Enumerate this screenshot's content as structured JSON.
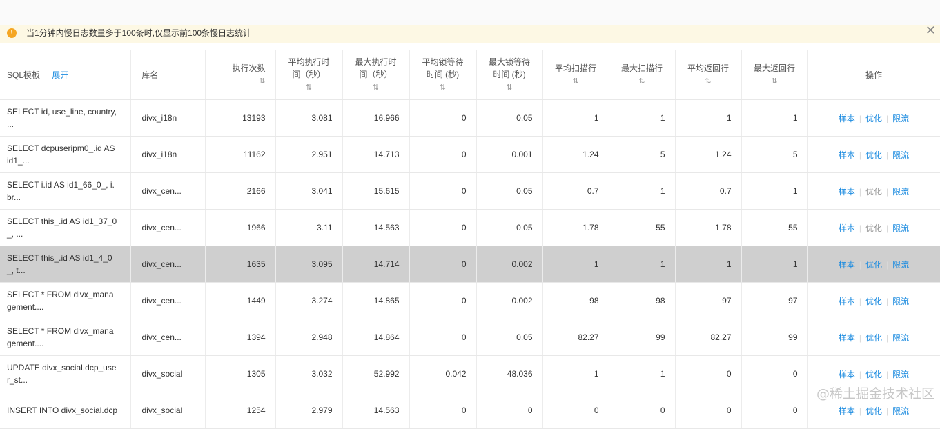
{
  "notice": {
    "message": "当1分钟内慢日志数量多于100条时,仅显示前100条慢日志统计",
    "close_symbol": "✕",
    "warn_icon": "exclamation"
  },
  "table": {
    "headers": {
      "sql": "SQL模板",
      "expand": "展开",
      "db": "库名",
      "exec_count": "执行次数",
      "avg_exec_1": "平均执行时",
      "avg_exec_2": "间（秒）",
      "max_exec_1": "最大执行时",
      "max_exec_2": "间（秒）",
      "avg_lock_1": "平均锁等待",
      "avg_lock_2": "时间 (秒)",
      "max_lock_1": "最大锁等待",
      "max_lock_2": "时间 (秒)",
      "avg_scan": "平均扫描行",
      "max_scan": "最大扫描行",
      "avg_return": "平均返回行",
      "max_return": "最大返回行",
      "ops": "操作",
      "sort_symbol": "⇅"
    },
    "rows": [
      {
        "sql1": "SELECT id, use_line, country,",
        "sql2": "...",
        "db": "divx_i18n",
        "count": "13193",
        "avg_exec": "3.081",
        "max_exec": "16.966",
        "avg_lock": "0",
        "max_lock": "0.05",
        "avg_scan": "1",
        "max_scan": "1",
        "avg_ret": "1",
        "max_ret": "1"
      },
      {
        "sql1": "SELECT dcpuseripm0_.id AS",
        "sql2": "id1_...",
        "db": "divx_i18n",
        "count": "11162",
        "avg_exec": "2.951",
        "max_exec": "14.713",
        "avg_lock": "0",
        "max_lock": "0.001",
        "avg_scan": "1.24",
        "max_scan": "5",
        "avg_ret": "1.24",
        "max_ret": "5"
      },
      {
        "sql1": "SELECT i.id AS id1_66_0_, i.",
        "sql2": "br...",
        "db": "divx_cen...",
        "count": "2166",
        "avg_exec": "3.041",
        "max_exec": "15.615",
        "avg_lock": "0",
        "max_lock": "0.05",
        "avg_scan": "0.7",
        "max_scan": "1",
        "avg_ret": "0.7",
        "max_ret": "1"
      },
      {
        "sql1": "SELECT this_.id AS id1_37_0",
        "sql2": "_, ...",
        "db": "divx_cen...",
        "count": "1966",
        "avg_exec": "3.11",
        "max_exec": "14.563",
        "avg_lock": "0",
        "max_lock": "0.05",
        "avg_scan": "1.78",
        "max_scan": "55",
        "avg_ret": "1.78",
        "max_ret": "55"
      },
      {
        "sql1": "SELECT this_.id AS id1_4_0",
        "sql2": "_, t...",
        "db": "divx_cen...",
        "count": "1635",
        "avg_exec": "3.095",
        "max_exec": "14.714",
        "avg_lock": "0",
        "max_lock": "0.002",
        "avg_scan": "1",
        "max_scan": "1",
        "avg_ret": "1",
        "max_ret": "1"
      },
      {
        "sql1": "SELECT * FROM divx_mana",
        "sql2": "gement....",
        "db": "divx_cen...",
        "count": "1449",
        "avg_exec": "3.274",
        "max_exec": "14.865",
        "avg_lock": "0",
        "max_lock": "0.002",
        "avg_scan": "98",
        "max_scan": "98",
        "avg_ret": "97",
        "max_ret": "97"
      },
      {
        "sql1": "SELECT * FROM divx_mana",
        "sql2": "gement....",
        "db": "divx_cen...",
        "count": "1394",
        "avg_exec": "2.948",
        "max_exec": "14.864",
        "avg_lock": "0",
        "max_lock": "0.05",
        "avg_scan": "82.27",
        "max_scan": "99",
        "avg_ret": "82.27",
        "max_ret": "99"
      },
      {
        "sql1": "UPDATE divx_social.dcp_use",
        "sql2": "r_st...",
        "db": "divx_social",
        "count": "1305",
        "avg_exec": "3.032",
        "max_exec": "52.992",
        "avg_lock": "0.042",
        "max_lock": "48.036",
        "avg_scan": "1",
        "max_scan": "1",
        "avg_ret": "0",
        "max_ret": "0"
      },
      {
        "sql1": "INSERT INTO divx_social.dcp",
        "sql2": "",
        "db": "divx_social",
        "count": "1254",
        "avg_exec": "2.979",
        "max_exec": "14.563",
        "avg_lock": "0",
        "max_lock": "0",
        "avg_scan": "0",
        "max_scan": "0",
        "avg_ret": "0",
        "max_ret": "0"
      }
    ],
    "selected_row": 4,
    "ops": {
      "sample": "样本",
      "optimize": "优化",
      "throttle": "限流",
      "separator": "|"
    }
  },
  "watermark": "@稀土掘金技术社区"
}
